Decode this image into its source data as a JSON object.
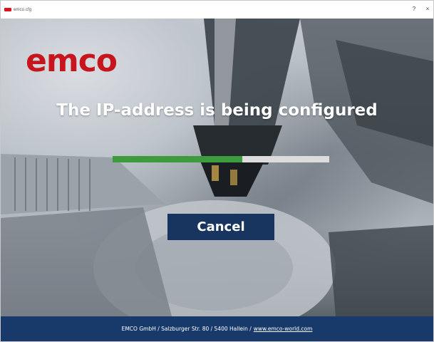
{
  "window": {
    "title": "emco.cfg",
    "help_glyph": "?",
    "close_glyph": "×"
  },
  "brand": {
    "logo_text": "emco",
    "accent_color": "#c8141c"
  },
  "main": {
    "headline": "The IP-address is being configured",
    "progress_fraction": 0.6,
    "cancel_label": "Cancel"
  },
  "footer": {
    "address": "EMCO GmbH / Salzburger Str. 80 / 5400 Hallein /",
    "link": "www.emco-world.com"
  },
  "colors": {
    "progress_fill": "#3c9b3c",
    "progress_track": "#dcdcdc",
    "button_bg": "#17355f",
    "footer_bg": "#173a6a"
  }
}
